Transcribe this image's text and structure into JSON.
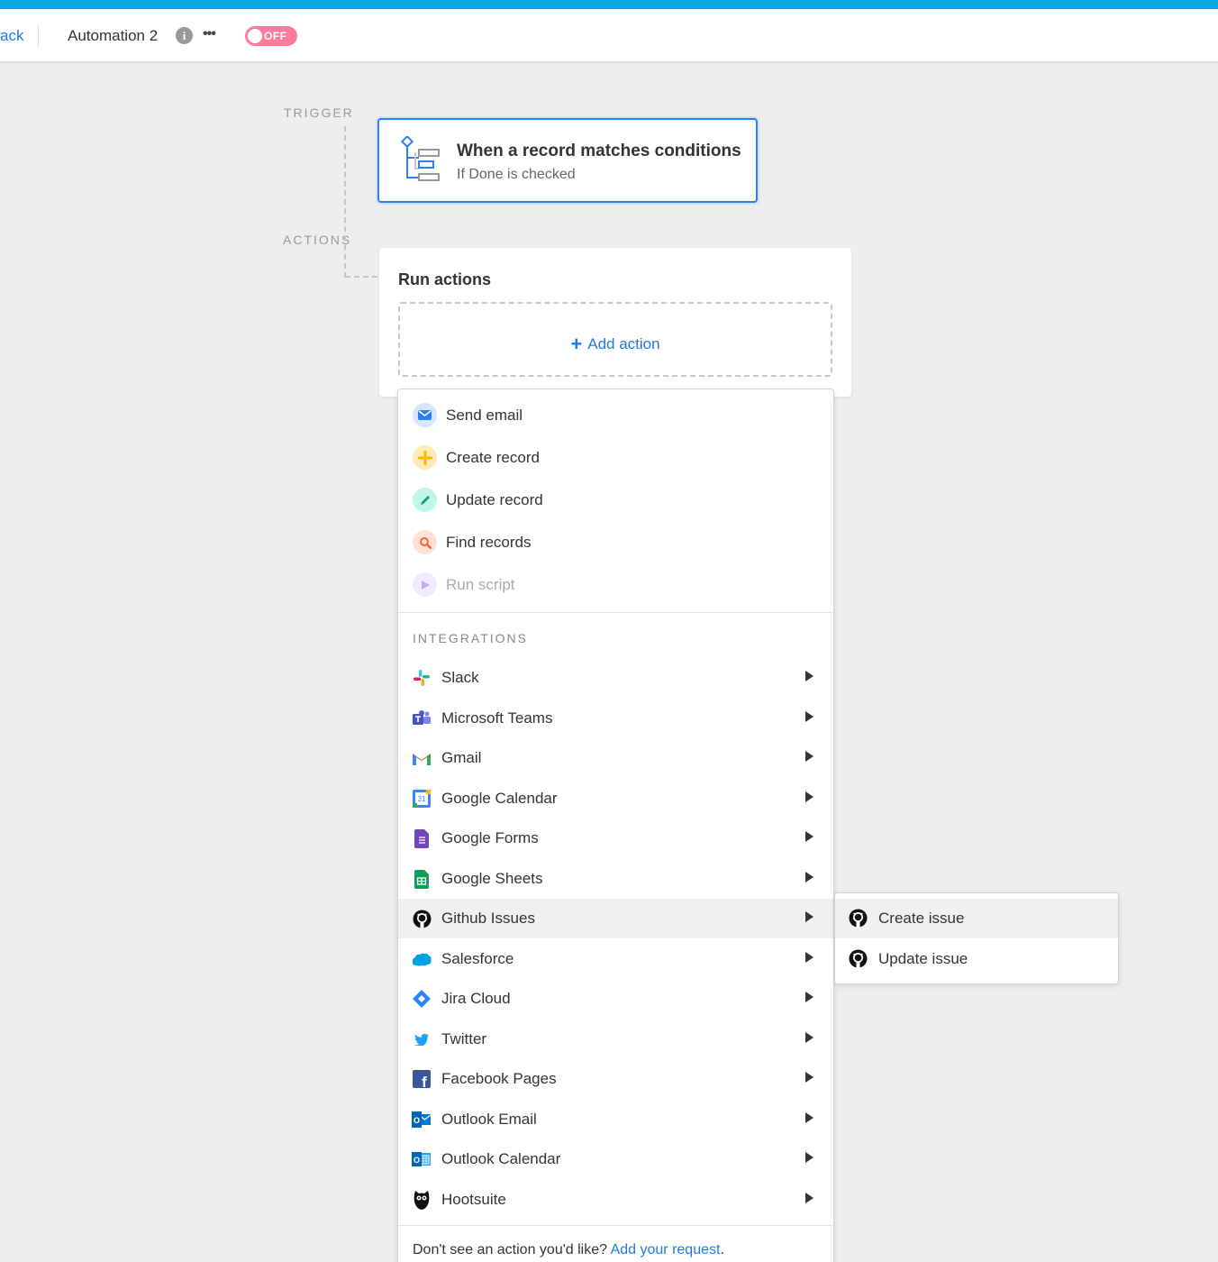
{
  "header": {
    "back_label": "ack",
    "automation_name": "Automation 2",
    "info_icon": "i",
    "more_icon": "•••",
    "toggle_label": "OFF",
    "accent_color": "#06a9e0"
  },
  "flow": {
    "trigger_label": "TRIGGER",
    "actions_label": "ACTIONS"
  },
  "trigger": {
    "title": "When a record matches conditions",
    "subtitle": "If Done is checked"
  },
  "actions": {
    "title": "Run actions",
    "add_label": "Add action",
    "add_icon": "+"
  },
  "menu": {
    "items": [
      {
        "label": "Send email",
        "icon": "envelope-icon",
        "color": "#2d7ff9"
      },
      {
        "label": "Create record",
        "icon": "plus-icon",
        "color": "#fcb400"
      },
      {
        "label": "Update record",
        "icon": "pencil-icon",
        "color": "#20c933"
      },
      {
        "label": "Find records",
        "icon": "search-icon",
        "color": "#ff6f2c"
      },
      {
        "label": "Run script",
        "icon": "play-icon",
        "color": "#8b46ff"
      }
    ],
    "integrations_label": "INTEGRATIONS",
    "integrations": [
      {
        "label": "Slack",
        "icon": "slack-icon"
      },
      {
        "label": "Microsoft Teams",
        "icon": "microsoft-teams-icon"
      },
      {
        "label": "Gmail",
        "icon": "gmail-icon"
      },
      {
        "label": "Google Calendar",
        "icon": "google-calendar-icon",
        "badge": "31"
      },
      {
        "label": "Google Forms",
        "icon": "google-forms-icon"
      },
      {
        "label": "Google Sheets",
        "icon": "google-sheets-icon"
      },
      {
        "label": "Github Issues",
        "icon": "github-icon"
      },
      {
        "label": "Salesforce",
        "icon": "salesforce-icon"
      },
      {
        "label": "Jira Cloud",
        "icon": "jira-icon"
      },
      {
        "label": "Twitter",
        "icon": "twitter-icon"
      },
      {
        "label": "Facebook Pages",
        "icon": "facebook-icon",
        "badge": "f"
      },
      {
        "label": "Outlook Email",
        "icon": "outlook-email-icon",
        "badge": "O"
      },
      {
        "label": "Outlook Calendar",
        "icon": "outlook-calendar-icon",
        "badge": "O"
      },
      {
        "label": "Hootsuite",
        "icon": "hootsuite-icon"
      }
    ],
    "footer_text": "Don't see an action you'd like? ",
    "footer_link": "Add your request",
    "footer_end": "."
  },
  "submenu": {
    "items": [
      {
        "label": "Create issue",
        "icon": "github-icon"
      },
      {
        "label": "Update issue",
        "icon": "github-icon"
      }
    ]
  }
}
